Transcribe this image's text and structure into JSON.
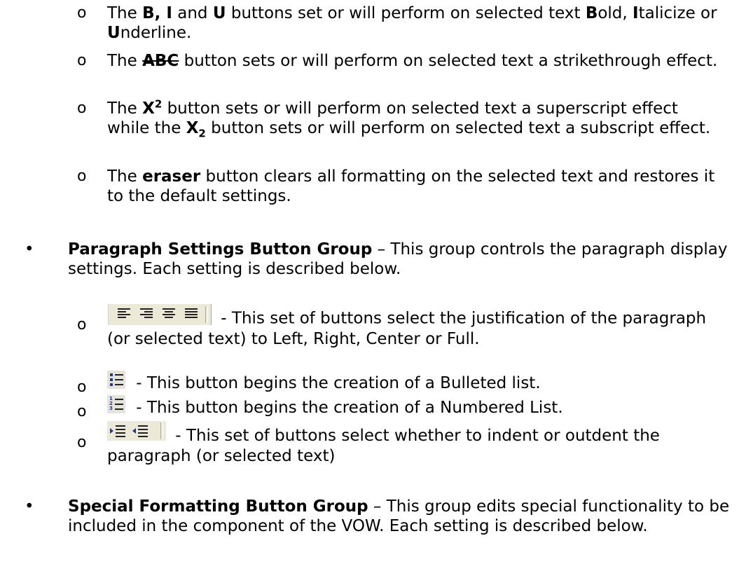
{
  "sub_marker": "o",
  "bullet_marker": "•",
  "format_items": {
    "biu": {
      "the": "The ",
      "b_i": "B, I",
      "and": " and ",
      "u": "U",
      "mid": " buttons set or will perform on selected text ",
      "bold_b": "B",
      "bold_rest": "old, ",
      "ital_i": "I",
      "ital_rest": "talicize or ",
      "und_u": "U",
      "und_rest": "nderline."
    },
    "strike": {
      "the": "The ",
      "abc": "ABC",
      "rest": " button sets or will perform on selected text a strikethrough effect."
    },
    "supsub": {
      "the": "The ",
      "x1": "X",
      "two1": "2",
      "mid": " button sets or will perform on selected text a superscript effect while the ",
      "x2": "X",
      "two2": "2",
      "rest": " button sets or will perform on selected text a subscript effect."
    },
    "eraser": {
      "the": "The ",
      "eraser": "eraser",
      "rest": " button clears all formatting on the selected text and restores it to the default settings."
    }
  },
  "paragraph_group": {
    "title": "Paragraph Settings Button Group",
    "rest": " – This group controls the paragraph display settings.  Each setting is described below.",
    "items": [
      {
        "text": " - This set of buttons select the justification of the paragraph (or selected text) to Left, Right, Center or Full.",
        "icon": "justify-icons"
      },
      {
        "text": " - This button begins the creation of a Bulleted list.",
        "icon": "bulleted-list-icon"
      },
      {
        "text": " - This button begins the creation of a Numbered List.",
        "icon": "numbered-list-icon"
      },
      {
        "text": " - This set of buttons select whether to indent or outdent the paragraph (or selected text)",
        "icon": "indent-outdent-icons"
      }
    ]
  },
  "special_group": {
    "title": "Special Formatting Button Group",
    "rest": " – This group edits special functionality to be included in the component of the VOW.  Each setting is described below."
  }
}
